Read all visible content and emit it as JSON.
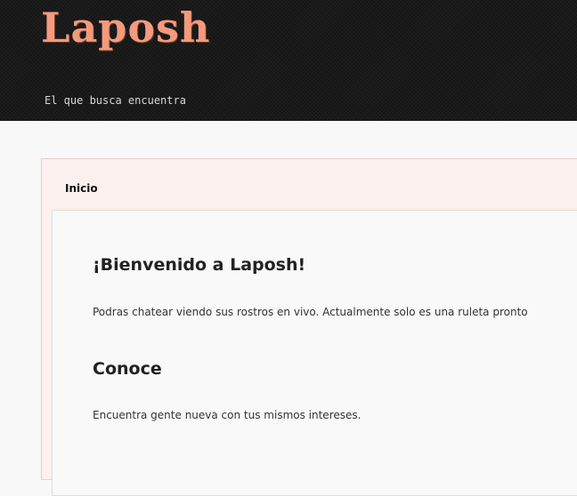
{
  "site": {
    "logo": "Laposh",
    "tagline": "El que busca encuentra"
  },
  "nav": {
    "tab": "Inicio"
  },
  "content": {
    "welcome_heading": "¡Bienvenido a Laposh!",
    "welcome_text": "Podras chatear viendo sus rostros en vivo. Actualmente solo es una ruleta pronto",
    "meet_heading": "Conoce",
    "meet_text": "Encuentra gente nueva con tus mismos intereses."
  },
  "colors": {
    "logo": "#f49a7d",
    "header_bg": "#1a1a1a",
    "panel_bg": "#fbf0ed"
  }
}
